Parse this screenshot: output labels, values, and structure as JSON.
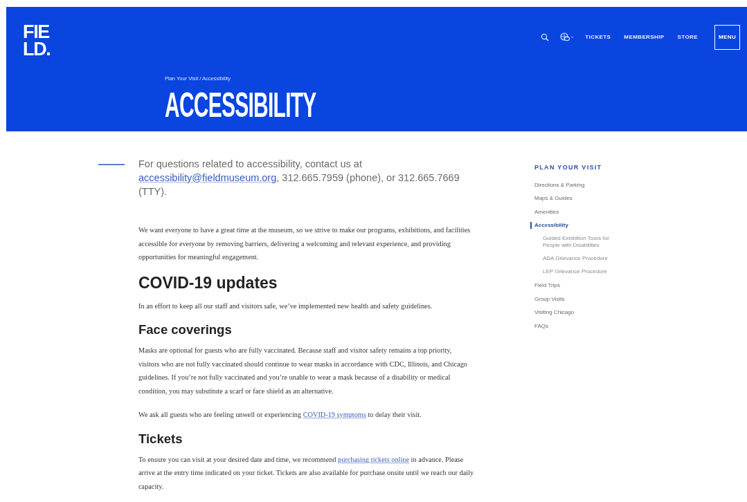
{
  "header": {
    "logo": [
      "FIE",
      "LD."
    ],
    "nav": [
      {
        "kind": "search"
      },
      {
        "kind": "language"
      },
      {
        "kind": "link",
        "label": "TICKETS"
      },
      {
        "kind": "link",
        "label": "MEMBERSHIP"
      },
      {
        "kind": "link",
        "label": "STORE"
      },
      {
        "kind": "menu",
        "label": "MENU"
      }
    ],
    "breadcrumb": "Plan Your Visit / Accessibility",
    "title": "ACCESSIBILITY"
  },
  "intro": [
    {
      "text": "For questions related to accessibility, contact us at "
    },
    {
      "link": "accessibility@fieldmuseum.org"
    },
    {
      "text": ", 312.665.7959 (phone), or 312.665.7669 (TTY)."
    }
  ],
  "blocks": [
    {
      "kind": "paragraph",
      "parts": [
        {
          "text": "We want everyone to have a great time at the museum, so we strive to make our programs, exhibitions, and facilities accessible for everyone by removing barriers, delivering a welcoming and relevant experience, and providing opportunities for meaningful engagement."
        }
      ]
    },
    {
      "kind": "h2",
      "text": "COVID-19 updates"
    },
    {
      "kind": "paragraph",
      "parts": [
        {
          "text": "In an effort to keep all our staff and visitors safe, we’ve implemented new health and safety guidelines."
        }
      ]
    },
    {
      "kind": "h3",
      "text": "Face coverings"
    },
    {
      "kind": "paragraph",
      "parts": [
        {
          "text": "Masks are optional for guests who are fully vaccinated. Because staff and visitor safety remains a top priority, visitors who are not fully vaccinated should continue to wear masks in accordance with CDC, Illinois, and Chicago guidelines. If you’re not fully vaccinated and you’re unable to wear a mask because of a disability or medical condition, you may substitute a scarf or face shield as an alternative."
        }
      ]
    },
    {
      "kind": "paragraph",
      "parts": [
        {
          "text": "We ask all guests who are feeling unwell or experiencing "
        },
        {
          "link": "COVID-19 symptoms"
        },
        {
          "text": " to delay their visit."
        }
      ]
    },
    {
      "kind": "h3",
      "text": "Tickets"
    },
    {
      "kind": "paragraph",
      "parts": [
        {
          "text": "To ensure you can visit at your desired date and time, we recommend "
        },
        {
          "link": "purchasing tickets online"
        },
        {
          "text": " in advance. Please arrive at the entry time indicated on your ticket. Tickets are also available for purchase onsite until we reach our daily capacity."
        }
      ]
    }
  ],
  "sidebar": {
    "heading": "PLAN YOUR VISIT",
    "items": [
      {
        "label": "Directions & Parking",
        "selected": false
      },
      {
        "label": "Maps & Guides",
        "selected": false
      },
      {
        "label": "Amenities",
        "selected": false
      },
      {
        "label": "Accessibility",
        "selected": true,
        "children": [
          {
            "label": "Guided Exhibition Tours for People with Disabilities",
            "selected": false
          },
          {
            "label": "ADA Grievance Procedure",
            "selected": false
          },
          {
            "label": "LEP Grievance Procedure",
            "selected": false
          }
        ]
      },
      {
        "label": "Field Trips",
        "selected": false
      },
      {
        "label": "Group Visits",
        "selected": false
      },
      {
        "label": "Visiting Chicago",
        "selected": false
      },
      {
        "label": "FAQs",
        "selected": false
      }
    ]
  }
}
